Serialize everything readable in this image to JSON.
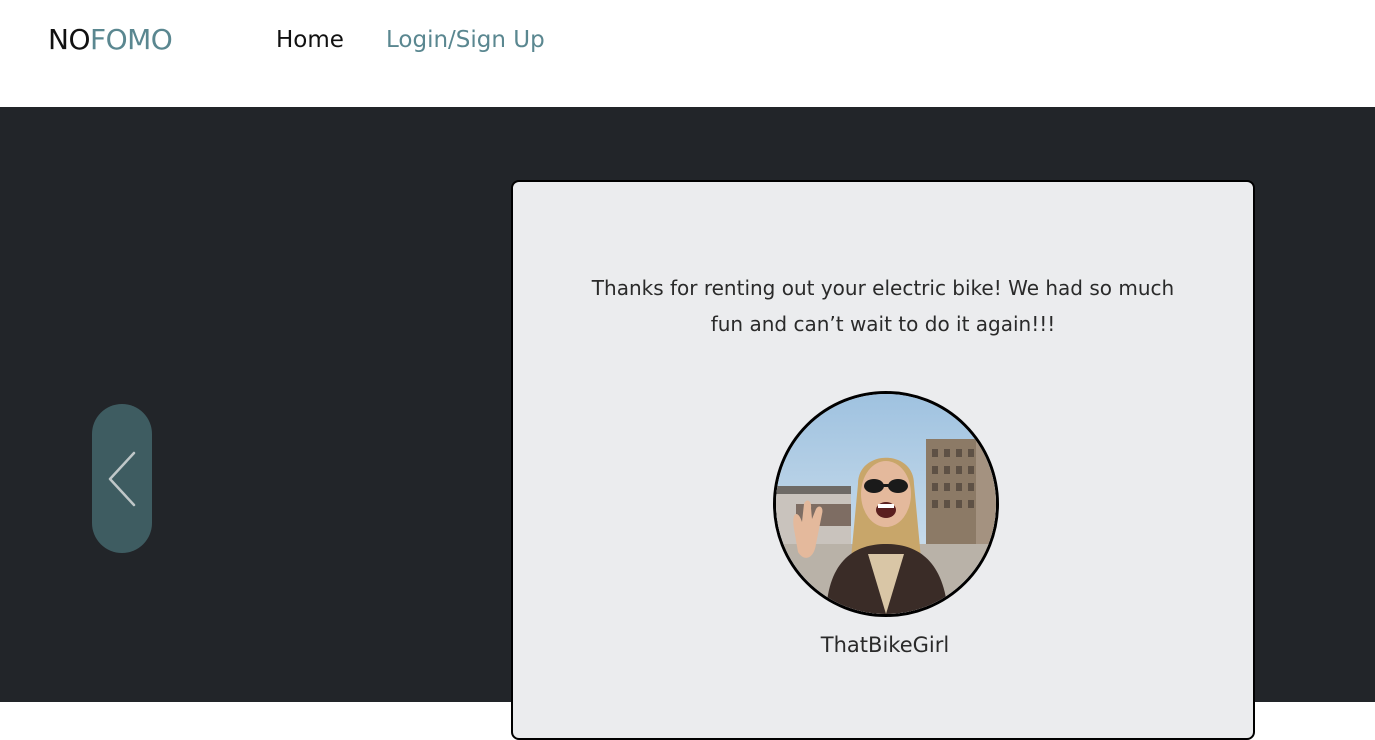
{
  "header": {
    "logo": {
      "part1": "NO",
      "part2": "FOMO"
    },
    "nav": {
      "home": "Home",
      "login": "Login/Sign Up"
    }
  },
  "carousel": {
    "prev_icon": "chevron-left-icon",
    "testimonial": {
      "quote": "Thanks for renting out your electric bike! We had so much fun and can’t wait to do it again!!!",
      "username": "ThatBikeGirl",
      "avatar": "photo of a smiling woman with sunglasses waving"
    }
  },
  "colors": {
    "accent": "#5a8790",
    "dark_bg": "#222529",
    "card_bg": "#ebecee",
    "prev_button_bg": "#3e5c61"
  }
}
